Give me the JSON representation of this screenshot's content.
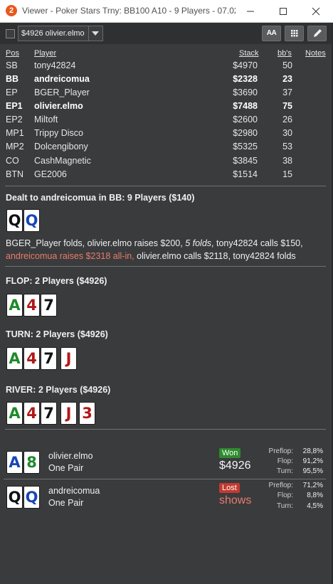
{
  "window": {
    "app_icon_glyph": "2",
    "title": "Viewer - Poker Stars Trny: BB100 A10 - 9 Players - 07.02...."
  },
  "toolbar": {
    "hand_select_value": "$4926 olivier.elmo",
    "font_button_label": "AA"
  },
  "table": {
    "headers": {
      "pos": "Pos",
      "player": "Player",
      "stack": "Stack",
      "bbs": "bb's",
      "notes": "Notes"
    },
    "rows": [
      {
        "pos": "SB",
        "player": "tony42824",
        "stack": "$4970",
        "bbs": "50",
        "bold": false
      },
      {
        "pos": "BB",
        "player": "andreicomua",
        "stack": "$2328",
        "bbs": "23",
        "bold": true
      },
      {
        "pos": "EP",
        "player": "BGER_Player",
        "stack": "$3690",
        "bbs": "37",
        "bold": false
      },
      {
        "pos": "EP1",
        "player": "olivier.elmo",
        "stack": "$7488",
        "bbs": "75",
        "bold": true
      },
      {
        "pos": "EP2",
        "player": "Miltoft",
        "stack": "$2600",
        "bbs": "26",
        "bold": false
      },
      {
        "pos": "MP1",
        "player": "Trippy Disco",
        "stack": "$2980",
        "bbs": "30",
        "bold": false
      },
      {
        "pos": "MP2",
        "player": "Dolcengibony",
        "stack": "$5325",
        "bbs": "53",
        "bold": false
      },
      {
        "pos": "CO",
        "player": "CashMagnetic",
        "stack": "$3845",
        "bbs": "38",
        "bold": false
      },
      {
        "pos": "BTN",
        "player": "GE2006",
        "stack": "$1514",
        "bbs": "15",
        "bold": false
      }
    ]
  },
  "preflop": {
    "title": "Dealt to andreicomua in BB: 9 Players ($140)",
    "cards": [
      {
        "rank": "Q",
        "suit": "s"
      },
      {
        "rank": "Q",
        "suit": "d"
      }
    ],
    "actions": {
      "a1": "BGER_Player folds, olivier.elmo raises $200, ",
      "a2": "5 folds",
      "a3": ", tony42824 calls $150,",
      "a4": "andreicomua raises $2318 all-in,",
      "a5": " olivier.elmo calls $2118, tony42824 folds"
    }
  },
  "flop": {
    "title": "FLOP: 2 Players ($4926)",
    "cards": [
      {
        "rank": "A",
        "suit": "c"
      },
      {
        "rank": "4",
        "suit": "h"
      },
      {
        "rank": "7",
        "suit": "s"
      }
    ]
  },
  "turn": {
    "title": "TURN: 2 Players ($4926)",
    "cards": [
      {
        "rank": "A",
        "suit": "c"
      },
      {
        "rank": "4",
        "suit": "h"
      },
      {
        "rank": "7",
        "suit": "s"
      },
      {
        "rank": "J",
        "suit": "h"
      }
    ]
  },
  "river": {
    "title": "RIVER: 2 Players ($4926)",
    "cards": [
      {
        "rank": "A",
        "suit": "c"
      },
      {
        "rank": "4",
        "suit": "h"
      },
      {
        "rank": "7",
        "suit": "s"
      },
      {
        "rank": "J",
        "suit": "h"
      },
      {
        "rank": "3",
        "suit": "h"
      }
    ]
  },
  "results": [
    {
      "cards": [
        {
          "rank": "A",
          "suit": "d"
        },
        {
          "rank": "8",
          "suit": "c"
        }
      ],
      "name": "olivier.elmo",
      "hand": "One Pair",
      "badge": "Won",
      "amount": "$4926",
      "equity": {
        "l1": "Preflop:",
        "v1": "28,8%",
        "l2": "Flop:",
        "v2": "91,2%",
        "l3": "Turn:",
        "v3": "95,5%"
      }
    },
    {
      "cards": [
        {
          "rank": "Q",
          "suit": "s"
        },
        {
          "rank": "Q",
          "suit": "d"
        }
      ],
      "name": "andreicomua",
      "hand": "One Pair",
      "badge": "Lost",
      "amount": "shows",
      "equity": {
        "l1": "Preflop:",
        "v1": "71,2%",
        "l2": "Flop:",
        "v2": "8,8%",
        "l3": "Turn:",
        "v3": "4,5%"
      }
    }
  ],
  "colors": {
    "background": "#3a3b3d",
    "hero_action": "#e97c6c",
    "won_badge": "#2e8b2e",
    "lost_badge": "#c23a30",
    "club": "#1f8a2a",
    "heart": "#b01818",
    "diamond": "#1747b5",
    "spade": "#111111"
  }
}
